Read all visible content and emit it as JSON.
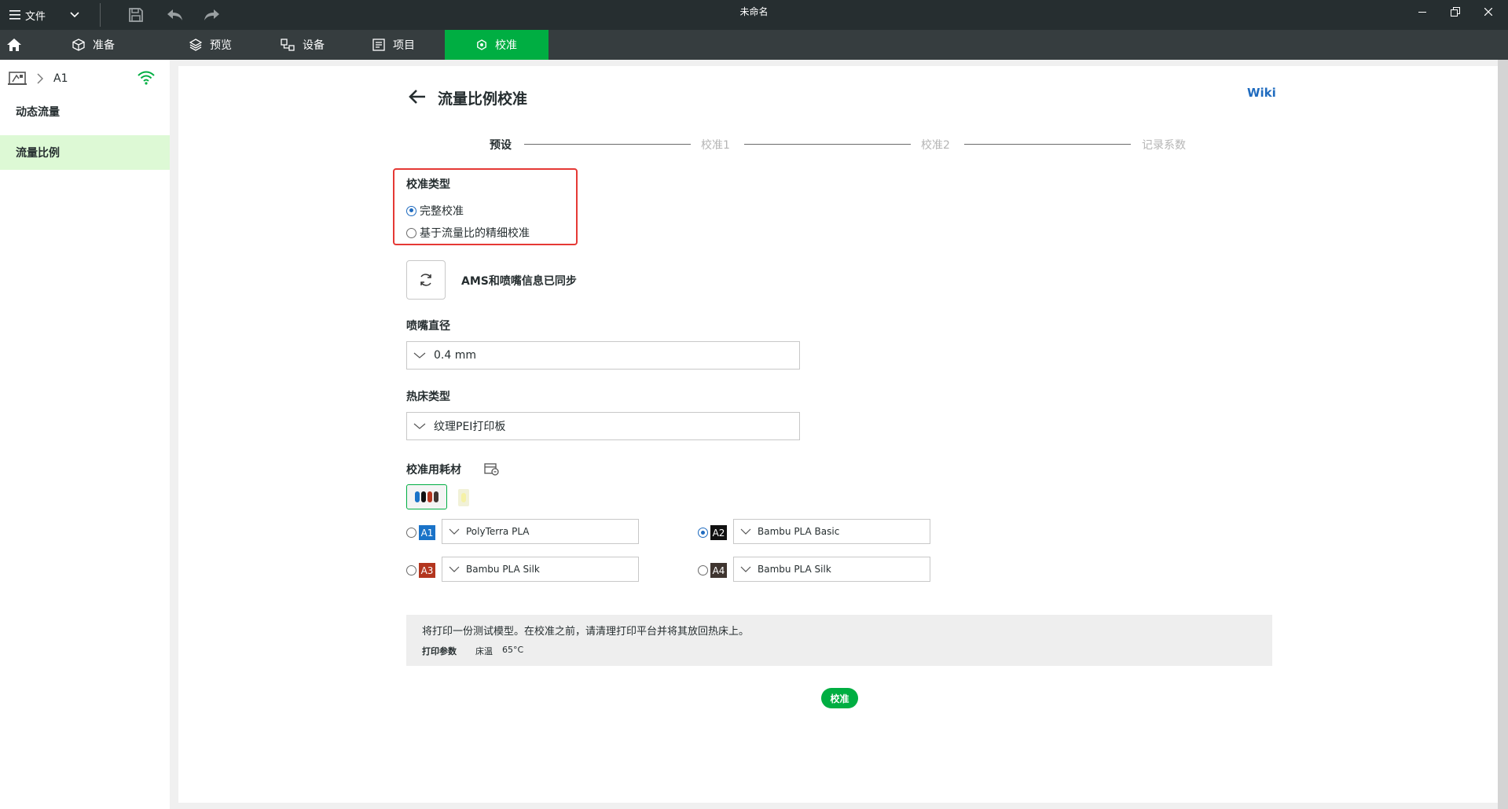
{
  "titlebar": {
    "menu_label": "文件",
    "window_title": "未命名"
  },
  "tabs": [
    {
      "label": "准备",
      "icon": "cube-icon"
    },
    {
      "label": "预览",
      "icon": "layers-icon"
    },
    {
      "label": "设备",
      "icon": "device-icon"
    },
    {
      "label": "项目",
      "icon": "project-icon"
    },
    {
      "label": "校准",
      "icon": "calibration-icon",
      "active": true
    }
  ],
  "sidebar": {
    "device_name": "A1",
    "items": [
      {
        "label": "动态流量"
      },
      {
        "label": "流量比例",
        "active": true
      }
    ]
  },
  "main": {
    "title": "流量比例校准",
    "wiki_link": "Wiki",
    "steps": [
      "预设",
      "校准1",
      "校准2",
      "记录系数"
    ],
    "calib_type": {
      "label": "校准类型",
      "options": [
        "完整校准",
        "基于流量比的精细校准"
      ],
      "selected": 0
    },
    "sync_text": "AMS和喷嘴信息已同步",
    "nozzle": {
      "label": "喷嘴直径",
      "value": "0.4 mm"
    },
    "bed": {
      "label": "热床类型",
      "value": "纹理PEI打印板"
    },
    "filament": {
      "label": "校准用耗材",
      "slots": [
        {
          "id": "A1",
          "name": "PolyTerra PLA",
          "color": "#1a73c8",
          "selected": false
        },
        {
          "id": "A2",
          "name": "Bambu PLA Basic",
          "color": "#111111",
          "selected": true
        },
        {
          "id": "A3",
          "name": "Bambu PLA Silk",
          "color": "#b3361f",
          "selected": false
        },
        {
          "id": "A4",
          "name": "Bambu PLA Silk",
          "color": "#3f3530",
          "selected": false
        }
      ]
    },
    "info": {
      "line1": "将打印一份测试模型。在校准之前，请清理打印平台并将其放回热床上。",
      "params_label": "打印参数",
      "bed_temp_label": "床温",
      "bed_temp_value": "65°C"
    },
    "calibrate_button": "校准"
  },
  "colors": {
    "accent": "#00ae42",
    "titlebar": "#262e30",
    "link": "#1f6bbf",
    "highlight_box": "#e53935"
  }
}
